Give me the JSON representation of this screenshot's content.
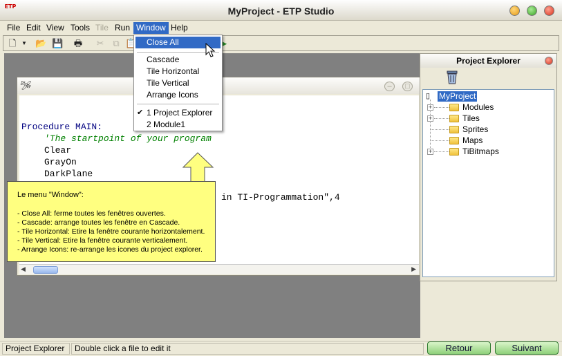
{
  "window": {
    "title": "MyProject - ETP Studio",
    "app_icon_text": "ETP"
  },
  "menubar": {
    "items": [
      {
        "label": "File",
        "state": "enabled"
      },
      {
        "label": "Edit",
        "state": "enabled"
      },
      {
        "label": "View",
        "state": "enabled"
      },
      {
        "label": "Tools",
        "state": "enabled"
      },
      {
        "label": "Tile",
        "state": "disabled"
      },
      {
        "label": "Run",
        "state": "enabled"
      },
      {
        "label": "Window",
        "state": "open"
      },
      {
        "label": "Help",
        "state": "enabled"
      }
    ]
  },
  "window_menu": {
    "items": [
      {
        "label": "Close All",
        "highlighted": true
      },
      {
        "label": "Cascade"
      },
      {
        "label": "Tile Horizontal"
      },
      {
        "label": "Tile Vertical"
      },
      {
        "label": "Arrange Icons"
      },
      {
        "label": "1 Project Explorer",
        "checked": true
      },
      {
        "label": "2 Module1"
      }
    ]
  },
  "editor": {
    "lines": [
      "Procedure MAIN:",
      "'The startpoint of your program",
      "Clear",
      "GrayOn",
      "DarkPlane",
      "in TI-Programmation\",4"
    ]
  },
  "callout": {
    "title": "Le menu \"Window\":",
    "lines": [
      "- Close All: ferme toutes les fenêtres ouvertes.",
      "- Cascade: arrange toutes les fenêtre en Cascade.",
      "- Tile Horizontal: Etire la fenêtre courante horizontalement.",
      "- Tile Vertical: Etire la fenêtre courante verticalement.",
      "- Arrange Icons: re-arrange les icones du project explorer."
    ]
  },
  "explorer": {
    "title": "Project Explorer",
    "root": "MyProject",
    "nodes": [
      {
        "label": "Modules",
        "expandable": true
      },
      {
        "label": "Tiles",
        "expandable": true
      },
      {
        "label": "Sprites",
        "expandable": false
      },
      {
        "label": "Maps",
        "expandable": false
      },
      {
        "label": "TiBitmaps",
        "expandable": true
      }
    ]
  },
  "statusbar": {
    "panel_name": "Project Explorer",
    "hint": "Double click a file to edit it"
  },
  "nav": {
    "back": "Retour",
    "next": "Suivant"
  },
  "colors": {
    "menu_highlight": "#316ac5",
    "callout_bg": "#ffff80",
    "comment": "#008000",
    "keyword": "#000080"
  }
}
